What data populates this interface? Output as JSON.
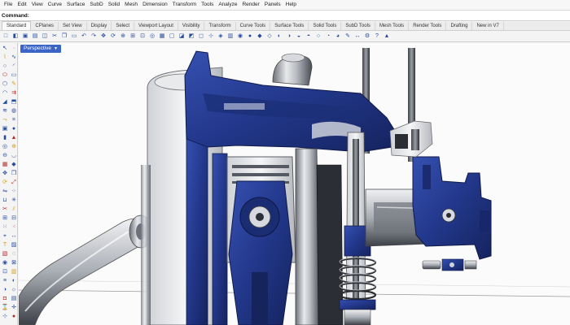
{
  "menubar": {
    "items": [
      "File",
      "Edit",
      "View",
      "Curve",
      "Surface",
      "SubD",
      "Solid",
      "Mesh",
      "Dimension",
      "Transform",
      "Tools",
      "Analyze",
      "Render",
      "Panels",
      "Help"
    ]
  },
  "command": {
    "label": "Command:"
  },
  "tabs": {
    "items": [
      "Standard",
      "CPlanes",
      "Set View",
      "Display",
      "Select",
      "Viewport Layout",
      "Visibility",
      "Transform",
      "Curve Tools",
      "Surface Tools",
      "Solid Tools",
      "SubD Tools",
      "Mesh Tools",
      "Render Tools",
      "Drafting",
      "New in V7"
    ],
    "active_index": 0
  },
  "toolbar": {
    "icons": [
      "new-file-icon",
      "open-file-icon",
      "save-icon",
      "print-icon",
      "import-icon",
      "cut-icon",
      "copy-icon",
      "paste-icon",
      "undo-icon",
      "redo-icon",
      "pan-icon",
      "rotate-view-icon",
      "zoom-icon",
      "zoom-window-icon",
      "zoom-extents-icon",
      "zoom-selected-icon",
      "four-view-icon",
      "maximize-icon",
      "cplane-icon",
      "named-view-icon",
      "select-all-icon",
      "grid-snap-icon",
      "lock-icon",
      "layer-icon",
      "properties-icon",
      "material-icon",
      "render-icon",
      "light-icon",
      "display-mode-icon",
      "wireframe-icon",
      "shaded-icon",
      "rendered-icon",
      "ghosted-icon",
      "xray-icon",
      "technical-icon",
      "artistic-icon",
      "pen-icon",
      "distance-icon",
      "options-icon",
      "help-icon"
    ]
  },
  "sidebar": {
    "icons": [
      "select-icon",
      "point-icon",
      "polyline-icon",
      "curve-icon",
      "circle-icon",
      "arc-icon",
      "ellipse-icon",
      "rectangle-icon",
      "polygon-icon",
      "freeform-icon",
      "fillet-curve-icon",
      "offset-icon",
      "surface-corner-icon",
      "extrude-icon",
      "loft-icon",
      "revolve-icon",
      "sweep-icon",
      "network-icon",
      "box-icon",
      "sphere-icon",
      "cylinder-icon",
      "cone-icon",
      "torus-icon",
      "boolean-union-icon",
      "boolean-diff-icon",
      "fillet-edge-icon",
      "mesh-icon",
      "subd-icon",
      "move-icon",
      "copy-obj-icon",
      "rotate-icon",
      "scale-icon",
      "mirror-icon",
      "array-icon",
      "join-icon",
      "explode-icon",
      "trim-icon",
      "split-icon",
      "group-icon",
      "ungroup-icon",
      "points-on-icon",
      "points-off-icon",
      "analyze-icon",
      "dimension-icon",
      "text-icon",
      "hatch-icon",
      "block-icon",
      "hide-icon",
      "show-icon",
      "lock-obj-icon",
      "unlock-icon",
      "layer-icon",
      "properties-icon",
      "render-icon",
      "material-icon",
      "light-icon",
      "camera-icon",
      "snapshot-icon",
      "history-icon",
      "gumball-icon",
      "osnap-icon",
      "record-icon"
    ]
  },
  "viewport": {
    "label": "Perspective"
  },
  "colors": {
    "accent": "#3a64c8",
    "section_blue": "#233b8f",
    "metal_light": "#e4e6ea",
    "metal_mid": "#9ea2aa",
    "metal_dark": "#2a2c31"
  }
}
